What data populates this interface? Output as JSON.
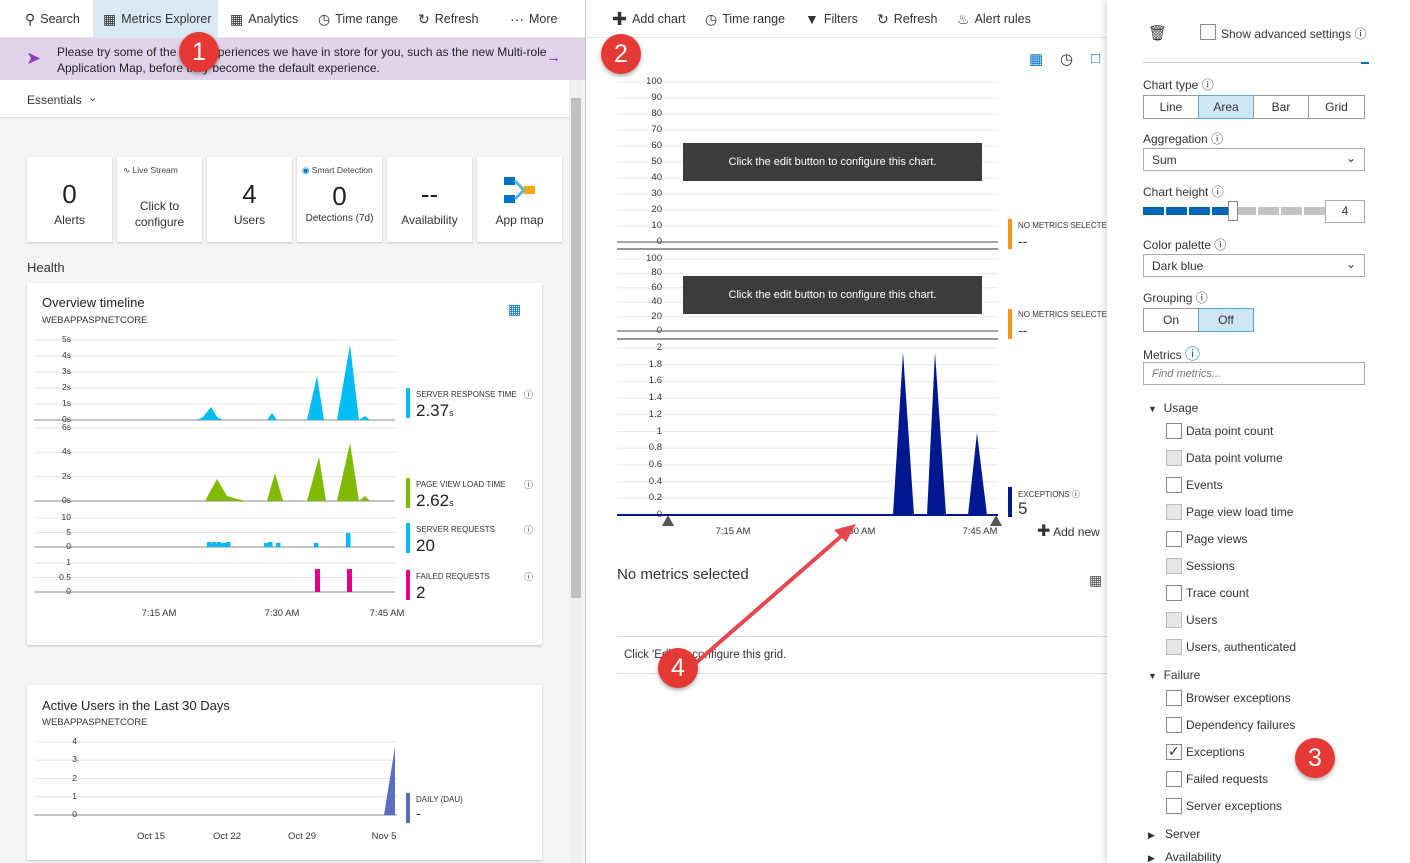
{
  "left": {
    "toolbar": {
      "search": "Search",
      "metrics_explorer": "Metrics Explorer",
      "analytics": "Analytics",
      "time_range": "Time range",
      "refresh": "Refresh",
      "more": "More"
    },
    "banner": {
      "line1": "Please try some of the new experiences we have in store for you, such as the new Multi-role",
      "line2": "Application Map, before they become the default experience."
    },
    "essentials": "Essentials",
    "tiles": {
      "alerts": {
        "value": "0",
        "label": "Alerts"
      },
      "live_stream": {
        "title": "Live Stream",
        "line1": "Click to",
        "line2": "configure"
      },
      "users": {
        "value": "4",
        "label": "Users"
      },
      "smart": {
        "title": "Smart Detection",
        "value": "0",
        "label": "Detections (7d)"
      },
      "availability": {
        "value": "--",
        "label": "Availability"
      },
      "app_map": {
        "label": "App map"
      }
    },
    "health": "Health",
    "overview": {
      "title": "Overview timeline",
      "subtitle": "WEBAPPASPNETCORE",
      "ticks1": [
        "5s",
        "4s",
        "3s",
        "2s",
        "1s",
        "0s"
      ],
      "ticks2": [
        "6s",
        "4s",
        "2s",
        "0s"
      ],
      "ticks3": [
        "10",
        "5",
        "0"
      ],
      "ticks4": [
        "1",
        "0.5",
        "0"
      ],
      "x_ticks": [
        "7:15 AM",
        "7:30 AM",
        "7:45 AM"
      ],
      "metrics": [
        {
          "label": "SERVER RESPONSE TIME",
          "value": "2.37",
          "unit": "s",
          "color": "#00bcf2"
        },
        {
          "label": "PAGE VIEW LOAD TIME",
          "value": "2.62",
          "unit": "s",
          "color": "#7fba00"
        },
        {
          "label": "SERVER REQUESTS",
          "value": "20",
          "unit": "",
          "color": "#00bcf2"
        },
        {
          "label": "FAILED REQUESTS",
          "value": "2",
          "unit": "",
          "color": "#e3008c"
        }
      ]
    },
    "active_users": {
      "title": "Active Users in the Last 30 Days",
      "subtitle": "WEBAPPASPNETCORE",
      "y_ticks": [
        "4",
        "3",
        "2",
        "1",
        "0"
      ],
      "x_ticks": [
        "Oct 15",
        "Oct 22",
        "Oct 29",
        "Nov 5"
      ],
      "metric_label": "DAILY (DAU)",
      "metric_value": "-"
    }
  },
  "mid": {
    "toolbar": {
      "add_chart": "Add chart",
      "time_range": "Time range",
      "filters": "Filters",
      "refresh": "Refresh",
      "alert_rules": "Alert rules"
    },
    "chart1": {
      "y_ticks": [
        "100",
        "90",
        "80",
        "70",
        "60",
        "50",
        "40",
        "30",
        "20",
        "10",
        "0"
      ],
      "message": "Click the edit button to configure this chart.",
      "metric_label": "NO METRICS SELECTED",
      "metric_value": "--"
    },
    "chart2": {
      "y_ticks": [
        "100",
        "80",
        "60",
        "40",
        "20",
        "0"
      ],
      "message": "Click the edit button to configure this chart.",
      "metric_label": "NO METRICS SELECTED",
      "metric_value": "--"
    },
    "chart3": {
      "y_ticks": [
        "2",
        "1.8",
        "1.6",
        "1.4",
        "1.2",
        "1",
        "0.8",
        "0.6",
        "0.4",
        "0.2",
        "0"
      ],
      "x_ticks": [
        "7:15 AM",
        "7:30 AM",
        "7:45 AM"
      ],
      "metric_label": "EXCEPTIONS",
      "metric_value": "5",
      "color": "#00188f"
    },
    "add_new": "Add new",
    "grid": {
      "title": "No metrics selected",
      "message": "Click 'Edit' to configure this grid."
    }
  },
  "right": {
    "show_advanced": "Show advanced settings",
    "chart_type": {
      "label": "Chart type",
      "options": [
        "Line",
        "Area",
        "Bar",
        "Grid"
      ],
      "selected": "Area"
    },
    "aggregation": {
      "label": "Aggregation",
      "value": "Sum"
    },
    "chart_height": {
      "label": "Chart height",
      "value": "4",
      "level": 4,
      "max": 8
    },
    "color_palette": {
      "label": "Color palette",
      "value": "Dark blue"
    },
    "grouping": {
      "label": "Grouping",
      "options": [
        "On",
        "Off"
      ],
      "selected": "Off"
    },
    "metrics_label": "Metrics",
    "find_placeholder": "Find metrics...",
    "usage": {
      "label": "Usage",
      "items": [
        {
          "label": "Data point count",
          "disabled": false
        },
        {
          "label": "Data point volume",
          "disabled": true
        },
        {
          "label": "Events",
          "disabled": false
        },
        {
          "label": "Page view load time",
          "disabled": true
        },
        {
          "label": "Page views",
          "disabled": false
        },
        {
          "label": "Sessions",
          "disabled": true
        },
        {
          "label": "Trace count",
          "disabled": false
        },
        {
          "label": "Users",
          "disabled": true
        },
        {
          "label": "Users, authenticated",
          "disabled": true
        }
      ]
    },
    "failure": {
      "label": "Failure",
      "items": [
        {
          "label": "Browser exceptions",
          "checked": false
        },
        {
          "label": "Dependency failures",
          "checked": false
        },
        {
          "label": "Exceptions",
          "checked": true
        },
        {
          "label": "Failed requests",
          "checked": false
        },
        {
          "label": "Server exceptions",
          "checked": false
        }
      ]
    },
    "server": "Server",
    "availability": "Availability"
  },
  "callouts": [
    "1",
    "2",
    "3",
    "4"
  ],
  "colors": {
    "accent": "#0072c6",
    "callout": "#e53935",
    "arrow": "#e8474f"
  }
}
